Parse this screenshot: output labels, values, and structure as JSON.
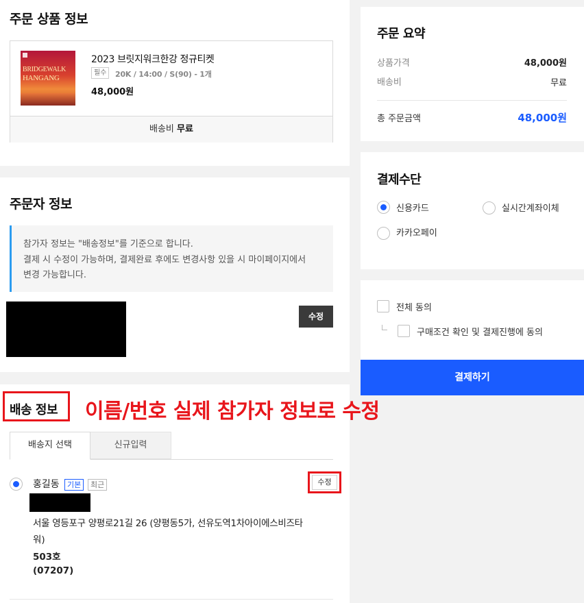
{
  "product_section": {
    "title": "주문 상품 정보",
    "item": {
      "thumbnail_line1": "BRIDGEWALK",
      "thumbnail_line2": "HANGANG",
      "name": "2023 브릿지워크한강 정규티켓",
      "option_badge": "필수",
      "option_text": "20K / 14:00 / S(90) - 1개",
      "price": "48,000원"
    },
    "shipping_label": "배송비",
    "shipping_value": "무료"
  },
  "orderer_section": {
    "title": "주문자 정보",
    "notice_line1": "참가자 정보는 \"배송정보\"를 기준으로 합니다.",
    "notice_line2": "결제 시 수정이 가능하며, 결제완료 후에도 변경사항 있을 시 마이페이지에서",
    "notice_line3": "변경 가능합니다.",
    "edit_button": "수정"
  },
  "delivery_section": {
    "title": "배송 정보",
    "annotation": "이름/번호 실제 참가자 정보로 수정",
    "tabs": [
      "배송지 선택",
      "신규입력"
    ],
    "address": {
      "name": "홍길동",
      "badge_default": "기본",
      "badge_recent": "최근",
      "edit_button": "수정",
      "line1": "서울 영등포구 양평로21길 26 (양평동5가, 선유도역1차아이에스비즈타",
      "line2": "워)",
      "detail": "503호",
      "zip": "(07207)"
    }
  },
  "summary": {
    "title": "주문 요약",
    "rows": [
      {
        "label": "상품가격",
        "value": "48,000원"
      },
      {
        "label": "배송비",
        "value": "무료"
      }
    ],
    "total_label": "총 주문금액",
    "total_value": "48,000원"
  },
  "payment": {
    "title": "결제수단",
    "options": [
      "신용카드",
      "실시간계좌이체",
      "카카오페이"
    ],
    "selected": "신용카드"
  },
  "agreement": {
    "all": "전체 동의",
    "sub": "구매조건 확인 및 결제진행에 동의",
    "pay_button": "결제하기"
  },
  "colors": {
    "accent": "#1a5cff",
    "annotation_red": "#e8151b",
    "dark_button": "#3a3a3a",
    "notice_bar": "#2b9cf0"
  }
}
